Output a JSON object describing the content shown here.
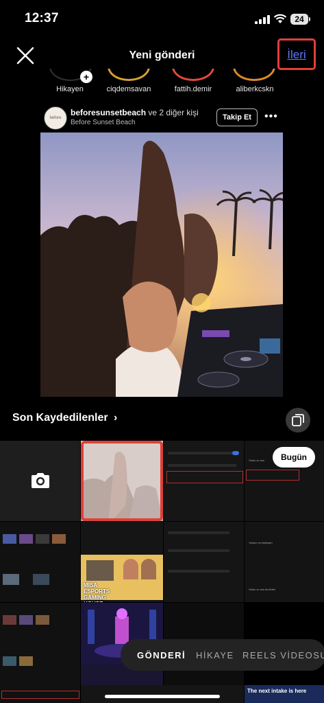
{
  "status_bar": {
    "time": "12:37",
    "battery": "24"
  },
  "header": {
    "title": "Yeni gönderi",
    "next_label": "İleri"
  },
  "stories": [
    "Hikayen",
    "ciqdemsavan",
    "fattih.demir",
    "aliberkcskn"
  ],
  "post": {
    "username": "beforesunsetbeach",
    "and_others": "ve 2 diğer kişi",
    "location": "Before Sunset Beach",
    "follow_label": "Takip Et",
    "avatar_text": "before sunset"
  },
  "gallery": {
    "album_label": "Son Kaydedilenler",
    "date_badge": "Bugün",
    "thumb_texts": {
      "esports": "MISA ESPORTS GAMING HOUSE",
      "news": "The next intake is here",
      "menu1": "Video ve ses",
      "menu2": "Yardım ve etkileşim",
      "menu3": "Video ve ses tercihleri"
    }
  },
  "modes": [
    "GÖNDERİ",
    "HİKAYE",
    "REELS VİDEOSU"
  ],
  "colors": {
    "highlight": "#e04038",
    "link": "#5b78ff",
    "background": "#000000"
  }
}
